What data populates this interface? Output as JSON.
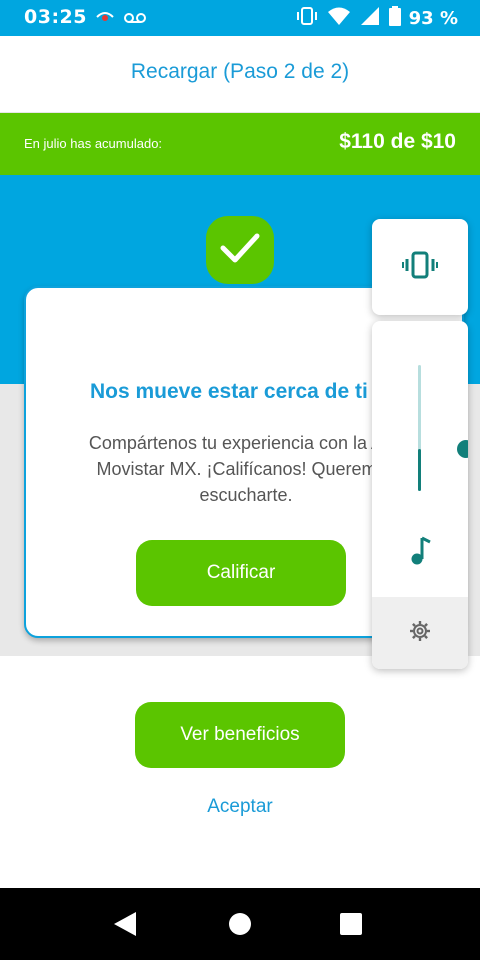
{
  "status_bar": {
    "time": "03:25",
    "battery_percent": "93 %",
    "icons": [
      "eye-icon",
      "voicemail-icon",
      "vibrate-icon",
      "wifi-icon",
      "signal-icon",
      "battery-icon"
    ]
  },
  "header": {
    "title": "Recargar (Paso 2 de 2)"
  },
  "accumulated": {
    "label": "En julio has acumulado:",
    "value": "$110 de $10"
  },
  "modal": {
    "title": "Nos mueve estar cerca de ti",
    "text": "Compártenos tu experiencia con la App Movistar MX. ¡Califícanos! Queremos escucharte.",
    "rate_button": "Calificar"
  },
  "actions": {
    "benefits_button": "Ver beneficios",
    "accept_link": "Aceptar"
  },
  "volume_panel": {
    "ringer_mode": "vibrate",
    "level": 0.33,
    "icons": [
      "vibrate-icon",
      "music-note-icon",
      "settings-gear-icon"
    ]
  },
  "colors": {
    "brand_blue": "#00a6e0",
    "brand_green": "#5bc500",
    "title_blue": "#1a9bd7",
    "volume_teal": "#127f7a"
  }
}
